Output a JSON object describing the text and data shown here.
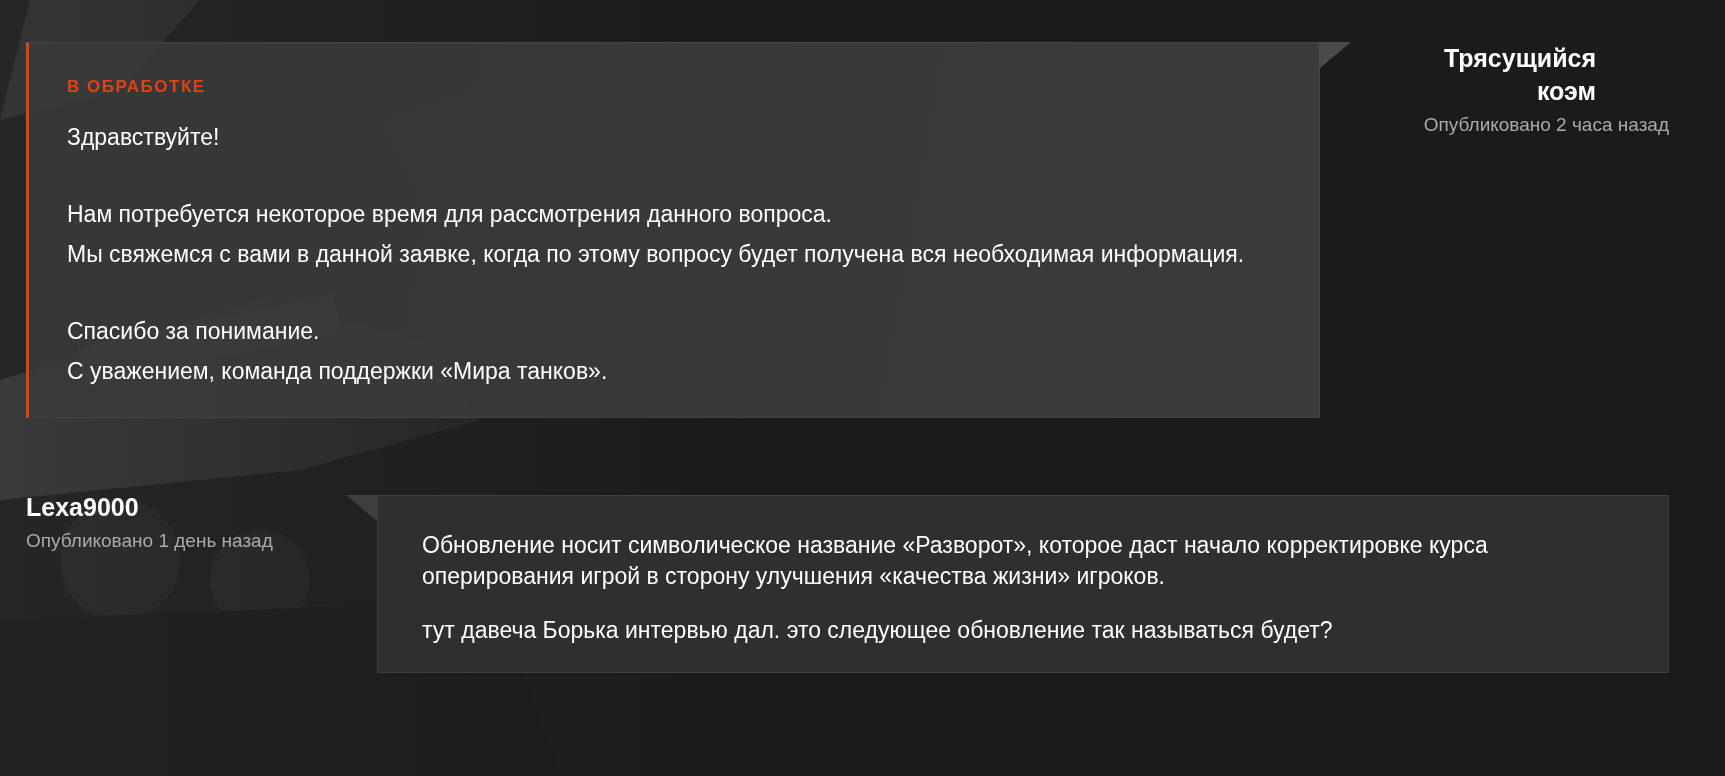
{
  "messages": [
    {
      "kind": "support",
      "status": "В ОБРАБОТКЕ",
      "author": "Трясущийся коэм",
      "published": "Опубликовано 2 часа назад",
      "paragraphs": [
        [
          "Здравствуйте!"
        ],
        [
          "Нам потребуется некоторое время для рассмотрения данного вопроса.",
          "Мы свяжемся с вами в данной заявке, когда по этому вопросу будет получена вся необходимая информация."
        ],
        [
          "Спасибо за понимание.",
          "С уважением, команда поддержки «Мира танков»."
        ]
      ]
    },
    {
      "kind": "user",
      "author": "Lexa9000",
      "published": "Опубликовано 1 день назад",
      "paragraphs": [
        [
          "Обновление носит символическое название «Разворот», которое даст начало корректировке курса оперирования игрой в сторону улучшения «качества жизни» игроков."
        ],
        [
          "тут давеча Борька интервью дал. это следующее обновление так называться будет?"
        ]
      ]
    }
  ]
}
